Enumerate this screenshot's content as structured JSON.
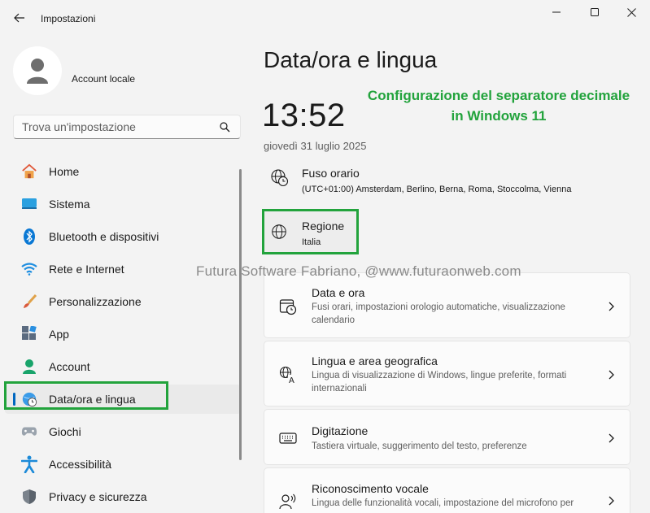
{
  "window": {
    "title": "Impostazioni"
  },
  "profile": {
    "name": "Account locale"
  },
  "search": {
    "placeholder": "Trova un'impostazione"
  },
  "sidebar": {
    "items": [
      {
        "label": "Home",
        "icon": "home-icon"
      },
      {
        "label": "Sistema",
        "icon": "system-icon"
      },
      {
        "label": "Bluetooth e dispositivi",
        "icon": "bluetooth-icon"
      },
      {
        "label": "Rete e Internet",
        "icon": "wifi-icon"
      },
      {
        "label": "Personalizzazione",
        "icon": "brush-icon"
      },
      {
        "label": "App",
        "icon": "apps-icon"
      },
      {
        "label": "Account",
        "icon": "person-icon"
      },
      {
        "label": "Data/ora e lingua",
        "icon": "globe-clock-icon",
        "selected": true
      },
      {
        "label": "Giochi",
        "icon": "gamepad-icon"
      },
      {
        "label": "Accessibilità",
        "icon": "accessibility-icon"
      },
      {
        "label": "Privacy e sicurezza",
        "icon": "shield-icon"
      }
    ]
  },
  "main": {
    "title": "Data/ora e lingua",
    "annotation_line1": "Configurazione del separatore decimale",
    "annotation_line2": "in Windows 11",
    "time": "13:52",
    "date": "giovedì 31 luglio 2025",
    "timezone": {
      "title": "Fuso orario",
      "value": "(UTC+01:00) Amsterdam, Berlino, Berna, Roma, Stoccolma, Vienna"
    },
    "region": {
      "title": "Regione",
      "value": "Italia"
    },
    "watermark": "Futura Software Fabriano, @www.futuraonweb.com",
    "cards": [
      {
        "title": "Data e ora",
        "desc": "Fusi orari, impostazioni orologio automatiche, visualizzazione calendario",
        "icon": "calendar-clock-icon"
      },
      {
        "title": "Lingua e area geografica",
        "desc": "Lingua di visualizzazione di Windows, lingue preferite, formati internazionali",
        "icon": "language-icon"
      },
      {
        "title": "Digitazione",
        "desc": "Tastiera virtuale, suggerimento del testo, preferenze",
        "icon": "keyboard-icon"
      },
      {
        "title": "Riconoscimento vocale",
        "desc": "Lingua delle funzionalità vocali, impostazione del microfono per",
        "icon": "speech-icon"
      }
    ]
  },
  "colors": {
    "accent": "#0067c0",
    "highlight": "#22a33c"
  }
}
